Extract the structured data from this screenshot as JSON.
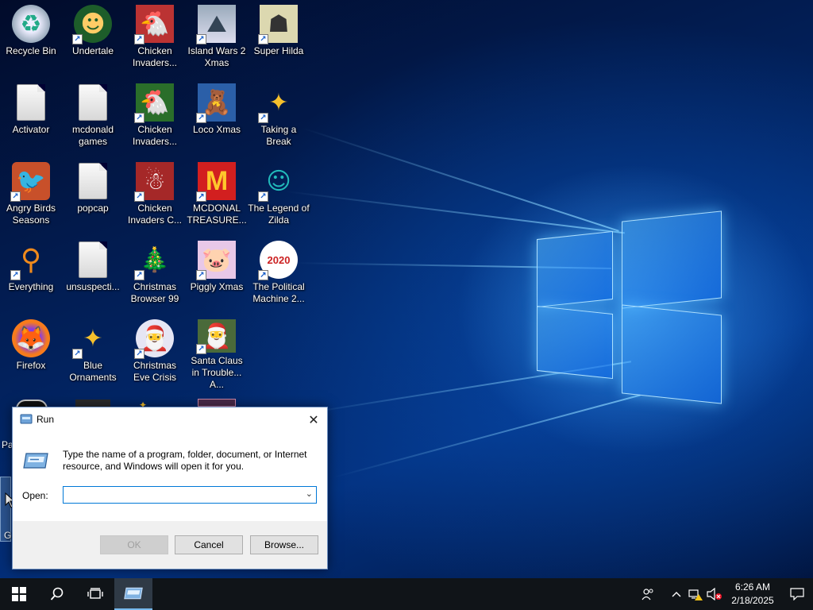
{
  "desktop": {
    "icons": [
      {
        "label": "Recycle Bin",
        "glyph": "♻"
      },
      {
        "label": "Undertale",
        "glyph": "☻"
      },
      {
        "label": "Chicken Invaders...",
        "glyph": "🐔"
      },
      {
        "label": "Island Wars 2 Xmas",
        "glyph": "⛰"
      },
      {
        "label": "Super Hilda",
        "glyph": "☗"
      },
      {
        "label": "Activator",
        "glyph": ""
      },
      {
        "label": "mcdonald games",
        "glyph": ""
      },
      {
        "label": "Chicken Invaders...",
        "glyph": "🐔"
      },
      {
        "label": "Loco Xmas",
        "glyph": "🧸"
      },
      {
        "label": "Taking a Break",
        "glyph": "✦"
      },
      {
        "label": "Angry Birds Seasons",
        "glyph": "🐦"
      },
      {
        "label": "popcap",
        "glyph": ""
      },
      {
        "label": "Chicken Invaders C...",
        "glyph": "☃"
      },
      {
        "label": "MCDONAL TREASURE...",
        "glyph": "M"
      },
      {
        "label": "The Legend of Zilda",
        "glyph": "☺"
      },
      {
        "label": "Everything",
        "glyph": "⚲"
      },
      {
        "label": "unsuspecti...",
        "glyph": ""
      },
      {
        "label": "Christmas Browser 99",
        "glyph": "🎄"
      },
      {
        "label": "Piggly Xmas",
        "glyph": "🐷"
      },
      {
        "label": "The Political Machine 2...",
        "glyph": "2020"
      },
      {
        "label": "Firefox",
        "glyph": "🦊"
      },
      {
        "label": "Blue Ornaments",
        "glyph": "✦"
      },
      {
        "label": "Christmas Eve Crisis",
        "glyph": "🎅"
      },
      {
        "label": "Santa Claus in Trouble... A...",
        "glyph": "🎅"
      }
    ],
    "partial_labels": {
      "left_row6": "Pa",
      "left_row7": "G"
    }
  },
  "run_dialog": {
    "title": "Run",
    "description": "Type the name of a program, folder, document, or Internet resource, and Windows will open it for you.",
    "open_label": "Open:",
    "open_value": "",
    "ok_label": "OK",
    "cancel_label": "Cancel",
    "browse_label": "Browse...",
    "close_glyph": "✕",
    "dropdown_glyph": "⌄"
  },
  "taskbar": {
    "start_glyph": "⊞",
    "search_glyph": "⚲",
    "taskview_glyph": "❐",
    "tray": {
      "people_glyph": "☺",
      "chevron_glyph": "^",
      "network_glyph": "⚠",
      "volume_glyph": "🔇",
      "notification_glyph": "▭"
    },
    "time": "6:26 AM",
    "date": "2/18/2025"
  },
  "colors": {
    "accent": "#0078d7",
    "taskbar": "#101418",
    "dialog_footer": "#f0f0f0"
  }
}
